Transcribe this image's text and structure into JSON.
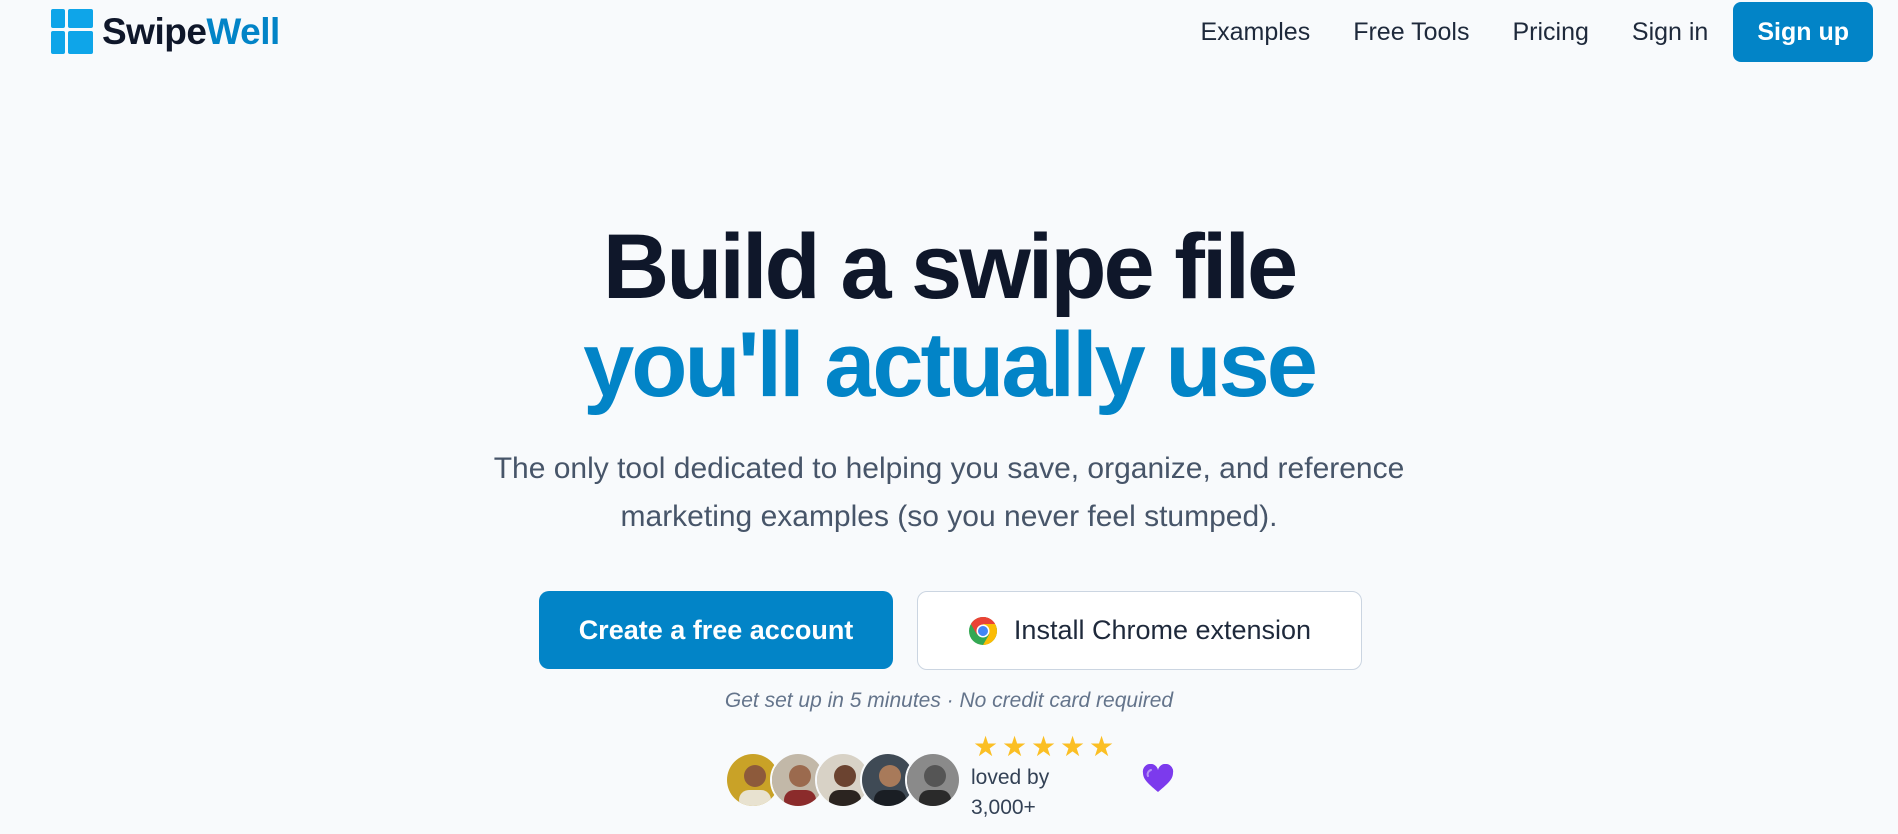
{
  "brand": {
    "name_part1": "Swipe",
    "name_part2": "Well",
    "color": "#0284c7"
  },
  "nav": {
    "links": [
      "Examples",
      "Free Tools",
      "Pricing",
      "Sign in"
    ],
    "signup": "Sign up"
  },
  "hero": {
    "title_line1": "Build a swipe file",
    "title_line2": "you'll actually use",
    "subtitle_line1": "The only tool dedicated to helping you save, organize, and reference",
    "subtitle_line2": "marketing examples (so you never feel stumped)."
  },
  "cta": {
    "primary": "Create a free account",
    "secondary": "Install Chrome extension",
    "note": "Get set up in 5 minutes · No credit card required"
  },
  "social_proof": {
    "rating_stars": 5,
    "loved_by": "loved by 3,000+",
    "avatars": [
      "avatar-1",
      "avatar-2",
      "avatar-3",
      "avatar-4",
      "avatar-5"
    ]
  }
}
